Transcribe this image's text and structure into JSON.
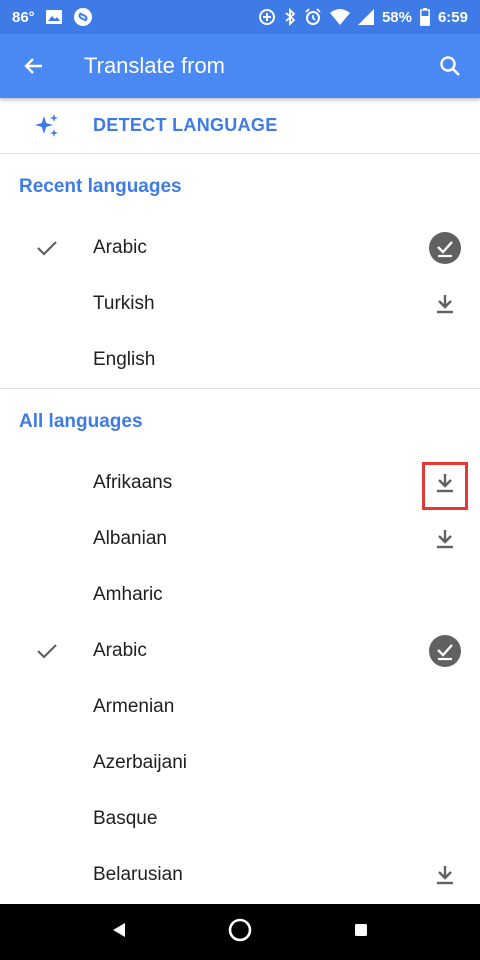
{
  "status": {
    "temperature": "86°",
    "battery": "58%",
    "time": "6:59"
  },
  "appbar": {
    "title": "Translate from"
  },
  "detect": {
    "label": "DETECT LANGUAGE"
  },
  "recent": {
    "header": "Recent languages",
    "items": [
      {
        "name": "Arabic",
        "checked": true,
        "action": "downloaded"
      },
      {
        "name": "Turkish",
        "checked": false,
        "action": "download"
      },
      {
        "name": "English",
        "checked": false,
        "action": "none"
      }
    ]
  },
  "all": {
    "header": "All languages",
    "items": [
      {
        "name": "Afrikaans",
        "checked": false,
        "action": "download"
      },
      {
        "name": "Albanian",
        "checked": false,
        "action": "download"
      },
      {
        "name": "Amharic",
        "checked": false,
        "action": "none"
      },
      {
        "name": "Arabic",
        "checked": true,
        "action": "downloaded"
      },
      {
        "name": "Armenian",
        "checked": false,
        "action": "none"
      },
      {
        "name": "Azerbaijani",
        "checked": false,
        "action": "none"
      },
      {
        "name": "Basque",
        "checked": false,
        "action": "none"
      },
      {
        "name": "Belarusian",
        "checked": false,
        "action": "download"
      }
    ]
  },
  "colors": {
    "accent": "#3e7be6",
    "appbar": "#4a89f3",
    "highlight": "#e53935"
  }
}
